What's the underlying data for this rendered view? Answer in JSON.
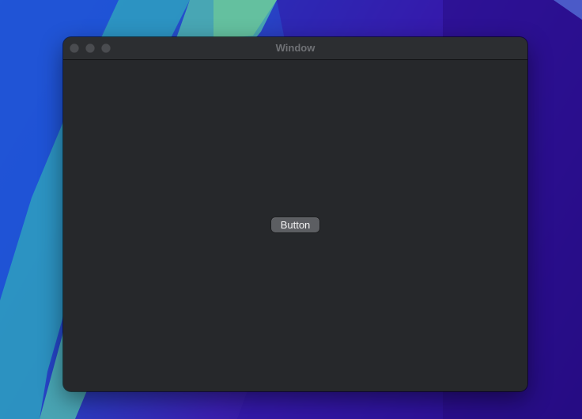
{
  "window": {
    "title": "Window",
    "traffic_lights": [
      "close",
      "minimize",
      "zoom"
    ]
  },
  "content": {
    "button_label": "Button"
  },
  "colors": {
    "window_bg": "#26282b",
    "titlebar_bg": "#2c2e31",
    "title_text": "#6f7175",
    "button_bg": "#5c5e62",
    "button_text": "#f2f2f3",
    "traffic_light_inactive": "#4a4c50"
  }
}
